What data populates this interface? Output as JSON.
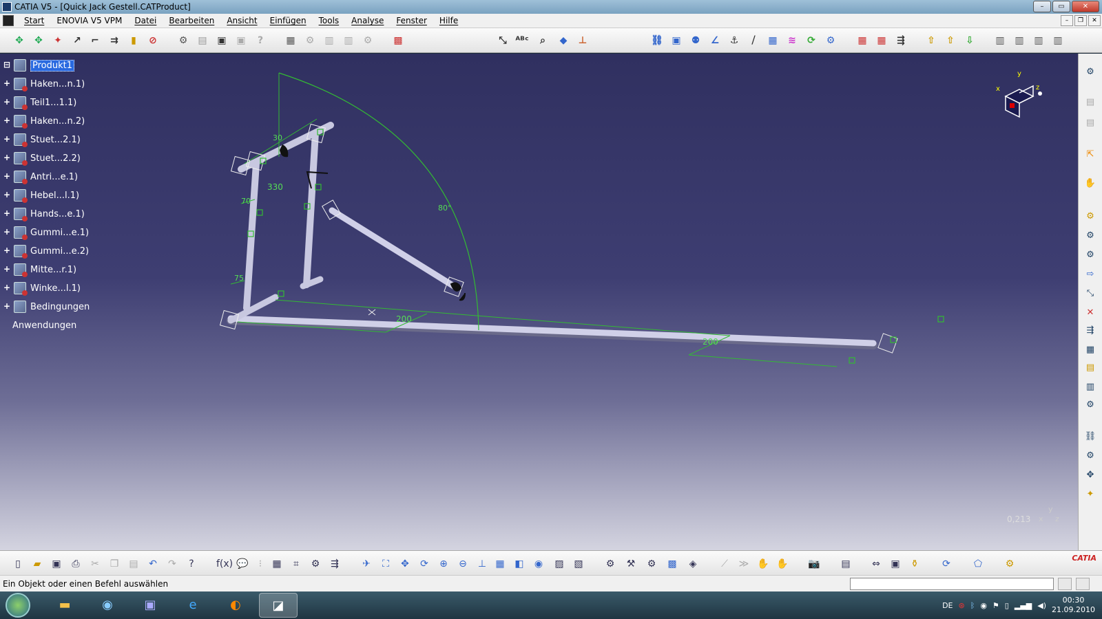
{
  "window": {
    "title": "CATIA V5 - [Quick Jack Gestell.CATProduct]"
  },
  "menubar": {
    "items": [
      "Start",
      "ENOVIA V5 VPM",
      "Datei",
      "Bearbeiten",
      "Ansicht",
      "Einfügen",
      "Tools",
      "Analyse",
      "Fenster",
      "Hilfe"
    ]
  },
  "tree": {
    "root": "Produkt1",
    "nodes": [
      "Haken...n.1)",
      "Teil1...1.1)",
      "Haken...n.2)",
      "Stuet...2.1)",
      "Stuet...2.2)",
      "Antri...e.1)",
      "Hebel...l.1)",
      "Hands...e.1)",
      "Gummi...e.1)",
      "Gummi...e.2)",
      "Mitte...r.1)",
      "Winke...l.1)",
      "Bedingungen"
    ],
    "footer": "Anwendungen"
  },
  "dimensions": {
    "d330": "330",
    "d200a": "200",
    "d200b": "200",
    "d70": "70",
    "d75": "75",
    "a80": "80°",
    "d30": "30"
  },
  "compass": {
    "x": "x",
    "y": "y",
    "z": "z"
  },
  "viewport": {
    "zoom": "0,213",
    "axis_x": "x",
    "axis_y": "y",
    "axis_z": "z"
  },
  "statusbar": {
    "message": "Ein Objekt oder einen Befehl auswählen"
  },
  "taskbar": {
    "lang": "DE",
    "time": "00:30",
    "date": "21.09.2010"
  },
  "logo": "CATIA"
}
